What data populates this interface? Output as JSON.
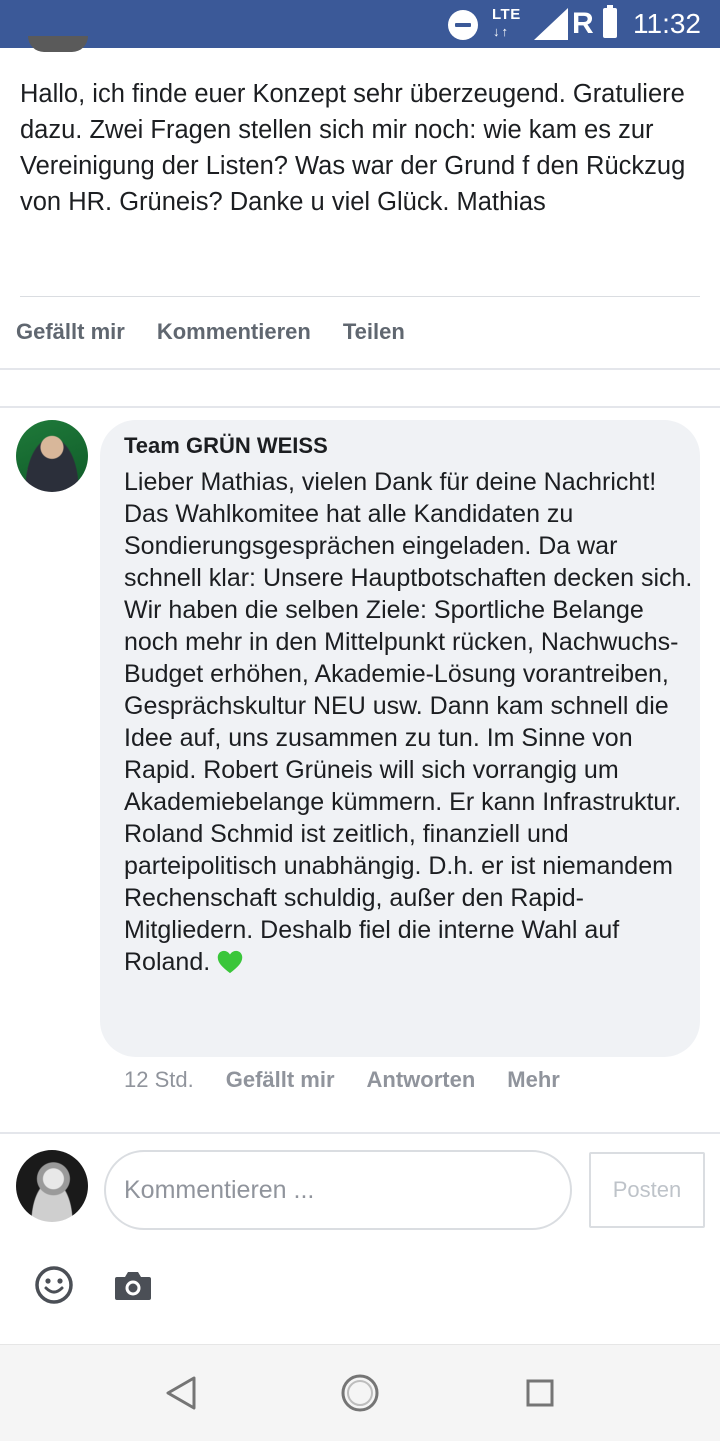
{
  "status_bar": {
    "network": "LTE",
    "roaming": "R",
    "time": "11:32",
    "icons": [
      "do-not-disturb-icon",
      "lte-data-icon",
      "signal-icon",
      "battery-icon"
    ]
  },
  "post": {
    "text": "Hallo, ich finde euer Konzept sehr überzeugend. Gratuliere dazu. Zwei Fragen stellen sich mir noch: wie kam es zur Vereinigung der Listen? Was war der Grund f den Rückzug von HR. Grüneis? Danke u viel Glück. Mathias",
    "actions": {
      "like": "Gefällt mir",
      "comment": "Kommentieren",
      "share": "Teilen"
    }
  },
  "comment": {
    "author": "Team GRÜN WEISS",
    "text": "Lieber Mathias, vielen Dank für deine Nachricht! Das Wahlkomitee hat alle Kandidaten zu Sondierungsgesprächen eingeladen. Da war schnell klar: Unsere Hauptbotschaften decken sich. Wir haben die selben Ziele: Sportliche Belange noch mehr in den Mittelpunkt rücken, Nachwuchs-Budget erhöhen, Akademie-Lösung vorantreiben, Gesprächskultur NEU usw. Dann kam schnell die Idee auf, uns zusammen zu tun. Im Sinne von Rapid. Robert Grüneis will sich vorrangig um Akademiebelange kümmern. Er kann Infrastruktur. Roland Schmid ist zeitlich, finanziell und parteipolitisch unabhängig. D.h. er ist niemandem Rechenschaft schuldig, außer den Rapid-Mitgliedern. Deshalb fiel die interne Wahl auf Roland.",
    "emoji": "green-heart-icon",
    "time": "12 Std.",
    "like": "Gefällt mir",
    "reply": "Antworten",
    "more": "Mehr"
  },
  "composer": {
    "placeholder": "Kommentieren ...",
    "value": "",
    "post_label": "Posten",
    "icons": [
      "emoji-icon",
      "camera-icon"
    ]
  },
  "nav": {
    "icons": [
      "back-icon",
      "home-icon",
      "recents-icon"
    ]
  },
  "colors": {
    "status_bar": "#3b5998",
    "bubble": "#f0f2f5",
    "heart": "#2ecc40",
    "text": "#1c1e21",
    "muted": "#606770"
  }
}
